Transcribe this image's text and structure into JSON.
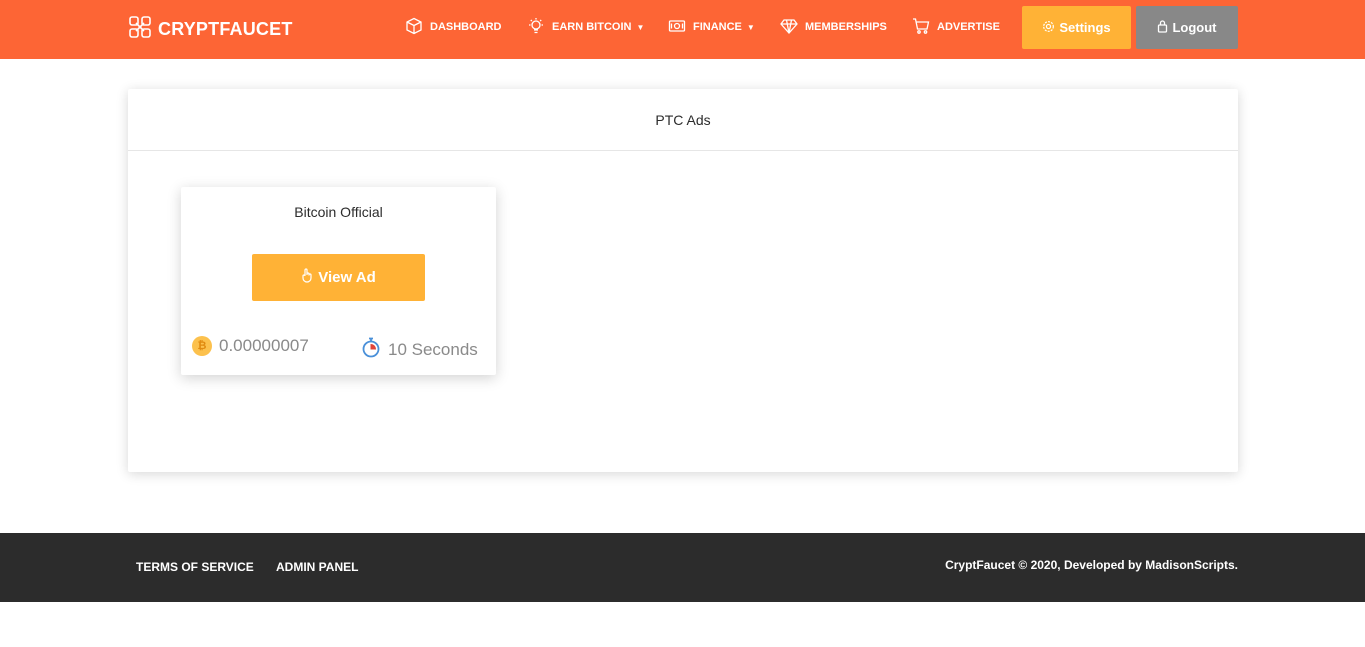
{
  "brand": {
    "name": "CRYPTFAUCET"
  },
  "nav": {
    "items": [
      {
        "label": "DASHBOARD"
      },
      {
        "label": "EARN BITCOIN"
      },
      {
        "label": "FINANCE"
      },
      {
        "label": "MEMBERSHIPS"
      },
      {
        "label": "ADVERTISE"
      }
    ],
    "settings_label": "Settings",
    "logout_label": "Logout"
  },
  "panel": {
    "title": "PTC Ads",
    "ads": [
      {
        "title": "Bitcoin Official",
        "button_label": "View Ad",
        "reward": "0.00000007",
        "duration": "10 Seconds"
      }
    ]
  },
  "footer": {
    "links": [
      {
        "label": "TERMS OF SERVICE"
      },
      {
        "label": "ADMIN PANEL"
      }
    ],
    "copyright": "CryptFaucet © 2020, Developed by MadisonScripts."
  },
  "colors": {
    "navbar": "#fd6535",
    "accent": "#ffb236",
    "logout": "#888888",
    "footer": "#2c2c2c"
  }
}
